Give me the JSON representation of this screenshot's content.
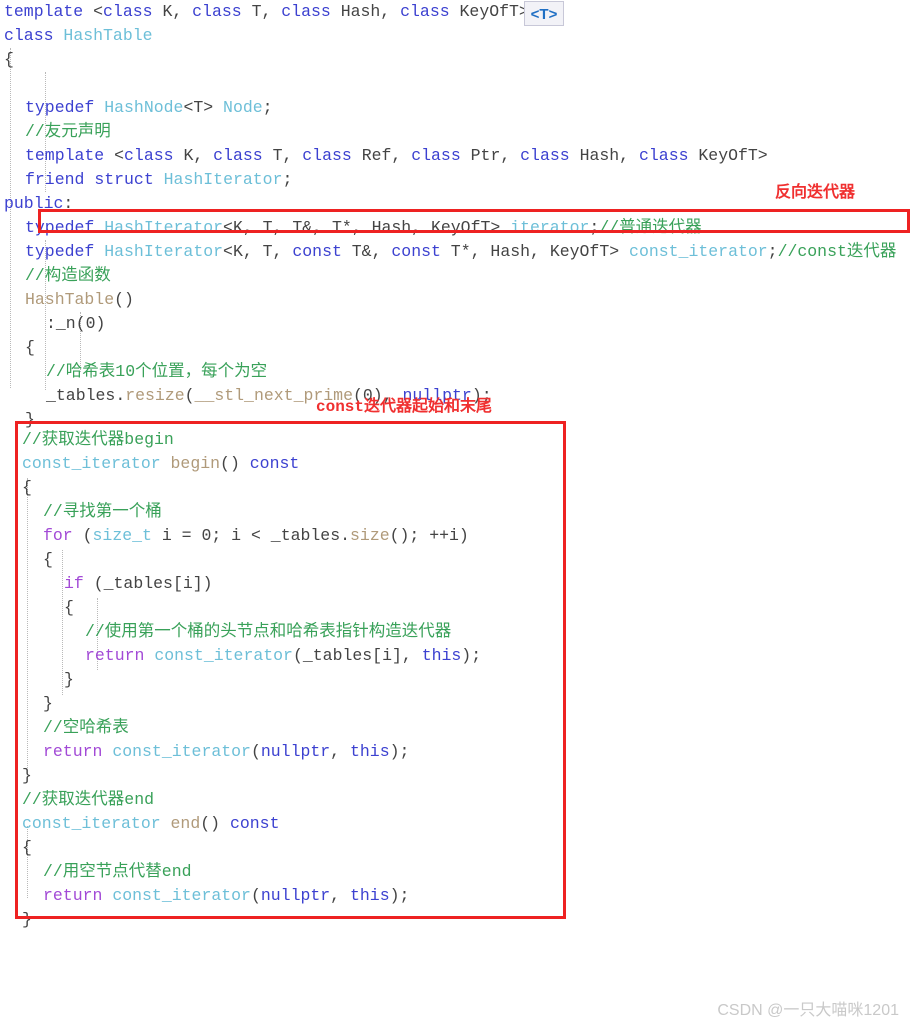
{
  "badge": {
    "label": "<T>"
  },
  "watermark": {
    "text": "CSDN @一只大喵咪1201"
  },
  "annotations": [
    {
      "name": "reverse-iterator-note",
      "text": "反向迭代器",
      "color": "#f03030"
    },
    {
      "name": "const-iterator-begin-end-note",
      "text": "const迭代器起始和末尾",
      "color": "#f03030"
    }
  ],
  "highlight_boxes": [
    {
      "name": "const-iterator-typedef-box",
      "color": "#ee2222"
    },
    {
      "name": "const-iterator-functions-box",
      "color": "#ee2222"
    }
  ],
  "code": {
    "language": "C++",
    "lines": [
      {
        "n": 1,
        "indent": 0,
        "tokens": [
          {
            "t": "template",
            "c": "kw"
          },
          {
            "t": " ",
            "c": "ident"
          },
          {
            "t": "<",
            "c": "ident"
          },
          {
            "t": "class",
            "c": "kw"
          },
          {
            "t": " K, ",
            "c": "ident"
          },
          {
            "t": "class",
            "c": "kw"
          },
          {
            "t": " T, ",
            "c": "ident"
          },
          {
            "t": "class",
            "c": "kw"
          },
          {
            "t": " Hash, ",
            "c": "ident"
          },
          {
            "t": "class",
            "c": "kw"
          },
          {
            "t": " KeyOfT>",
            "c": "ident"
          }
        ]
      },
      {
        "n": 2,
        "indent": 0,
        "tokens": [
          {
            "t": "class",
            "c": "kw"
          },
          {
            "t": " ",
            "c": "ident"
          },
          {
            "t": "HashTable",
            "c": "type"
          }
        ]
      },
      {
        "n": 3,
        "indent": 0,
        "tokens": [
          {
            "t": "{",
            "c": "ident"
          }
        ]
      },
      {
        "n": 4,
        "indent": 0,
        "tokens": []
      },
      {
        "n": 5,
        "indent": 1,
        "tokens": [
          {
            "t": "typedef",
            "c": "kw"
          },
          {
            "t": " ",
            "c": "ident"
          },
          {
            "t": "HashNode",
            "c": "type"
          },
          {
            "t": "<T> ",
            "c": "ident"
          },
          {
            "t": "Node",
            "c": "type"
          },
          {
            "t": ";",
            "c": "ident"
          }
        ]
      },
      {
        "n": 6,
        "indent": 1,
        "tokens": [
          {
            "t": "//友元声明",
            "c": "cmt"
          }
        ]
      },
      {
        "n": 7,
        "indent": 1,
        "tokens": [
          {
            "t": "template",
            "c": "kw"
          },
          {
            "t": " <",
            "c": "ident"
          },
          {
            "t": "class",
            "c": "kw"
          },
          {
            "t": " K, ",
            "c": "ident"
          },
          {
            "t": "class",
            "c": "kw"
          },
          {
            "t": " T, ",
            "c": "ident"
          },
          {
            "t": "class",
            "c": "kw"
          },
          {
            "t": " Ref, ",
            "c": "ident"
          },
          {
            "t": "class",
            "c": "kw"
          },
          {
            "t": " Ptr, ",
            "c": "ident"
          },
          {
            "t": "class",
            "c": "kw"
          },
          {
            "t": " Hash, ",
            "c": "ident"
          },
          {
            "t": "class",
            "c": "kw"
          },
          {
            "t": " KeyOfT>",
            "c": "ident"
          }
        ]
      },
      {
        "n": 8,
        "indent": 1,
        "tokens": [
          {
            "t": "friend",
            "c": "kw"
          },
          {
            "t": " ",
            "c": "ident"
          },
          {
            "t": "struct",
            "c": "kw"
          },
          {
            "t": " ",
            "c": "ident"
          },
          {
            "t": "HashIterator",
            "c": "type"
          },
          {
            "t": ";",
            "c": "ident"
          }
        ]
      },
      {
        "n": 9,
        "indent": 0,
        "tokens": [
          {
            "t": "public",
            "c": "kw"
          },
          {
            "t": ":",
            "c": "ident"
          }
        ]
      },
      {
        "n": 10,
        "indent": 1,
        "tokens": [
          {
            "t": "typedef",
            "c": "kw"
          },
          {
            "t": " ",
            "c": "ident"
          },
          {
            "t": "HashIterator",
            "c": "type"
          },
          {
            "t": "<K, T, T&, T*, Hash, KeyOfT> ",
            "c": "ident"
          },
          {
            "t": "iterator",
            "c": "type"
          },
          {
            "t": ";",
            "c": "ident"
          },
          {
            "t": "//普通迭代器",
            "c": "cmt"
          }
        ]
      },
      {
        "n": 11,
        "indent": 1,
        "tokens": [
          {
            "t": "typedef",
            "c": "kw"
          },
          {
            "t": " ",
            "c": "ident"
          },
          {
            "t": "HashIterator",
            "c": "type"
          },
          {
            "t": "<K, T, ",
            "c": "ident"
          },
          {
            "t": "const",
            "c": "kw"
          },
          {
            "t": " T&, ",
            "c": "ident"
          },
          {
            "t": "const",
            "c": "kw"
          },
          {
            "t": " T*, Hash, KeyOfT> ",
            "c": "ident"
          },
          {
            "t": "const_iterator",
            "c": "type"
          },
          {
            "t": ";",
            "c": "ident"
          },
          {
            "t": "//const迭代器",
            "c": "cmt"
          }
        ]
      },
      {
        "n": 12,
        "indent": 1,
        "tokens": [
          {
            "t": "//构造函数",
            "c": "cmt"
          }
        ]
      },
      {
        "n": 13,
        "indent": 1,
        "tokens": [
          {
            "t": "HashTable",
            "c": "fn"
          },
          {
            "t": "()",
            "c": "ident"
          }
        ]
      },
      {
        "n": 14,
        "indent": 2,
        "tokens": [
          {
            "t": ":",
            "c": "ident"
          },
          {
            "t": "_n",
            "c": "ident"
          },
          {
            "t": "(",
            "c": "ident"
          },
          {
            "t": "0",
            "c": "num"
          },
          {
            "t": ")",
            "c": "ident"
          }
        ]
      },
      {
        "n": 15,
        "indent": 1,
        "tokens": [
          {
            "t": "{",
            "c": "ident"
          }
        ]
      },
      {
        "n": 16,
        "indent": 2,
        "tokens": [
          {
            "t": "//哈希表10个位置，每个为空",
            "c": "cmt"
          }
        ]
      },
      {
        "n": 17,
        "indent": 2,
        "tokens": [
          {
            "t": "_tables",
            "c": "ident"
          },
          {
            "t": ".",
            "c": "ident"
          },
          {
            "t": "resize",
            "c": "fn"
          },
          {
            "t": "(",
            "c": "ident"
          },
          {
            "t": "__stl_next_prime",
            "c": "fn"
          },
          {
            "t": "(",
            "c": "ident"
          },
          {
            "t": "0",
            "c": "num"
          },
          {
            "t": "), ",
            "c": "ident"
          },
          {
            "t": "nullptr",
            "c": "kw"
          },
          {
            "t": ");",
            "c": "ident"
          }
        ]
      },
      {
        "n": 18,
        "indent": 1,
        "tokens": [
          {
            "t": "}",
            "c": "ident"
          }
        ]
      }
    ],
    "boxed_lines": [
      {
        "n": 19,
        "indent": 0,
        "tokens": [
          {
            "t": "//获取迭代器begin",
            "c": "cmt"
          }
        ]
      },
      {
        "n": 20,
        "indent": 0,
        "tokens": [
          {
            "t": "const_iterator",
            "c": "type"
          },
          {
            "t": " ",
            "c": "ident"
          },
          {
            "t": "begin",
            "c": "fn"
          },
          {
            "t": "() ",
            "c": "ident"
          },
          {
            "t": "const",
            "c": "kw"
          }
        ]
      },
      {
        "n": 21,
        "indent": 0,
        "tokens": [
          {
            "t": "{",
            "c": "ident"
          }
        ]
      },
      {
        "n": 22,
        "indent": 1,
        "tokens": [
          {
            "t": "//寻找第一个桶",
            "c": "cmt"
          }
        ]
      },
      {
        "n": 23,
        "indent": 1,
        "tokens": [
          {
            "t": "for",
            "c": "kw2"
          },
          {
            "t": " (",
            "c": "ident"
          },
          {
            "t": "size_t",
            "c": "type"
          },
          {
            "t": " i = ",
            "c": "ident"
          },
          {
            "t": "0",
            "c": "num"
          },
          {
            "t": "; i < ",
            "c": "ident"
          },
          {
            "t": "_tables",
            "c": "ident"
          },
          {
            "t": ".",
            "c": "ident"
          },
          {
            "t": "size",
            "c": "fn"
          },
          {
            "t": "(); ++i)",
            "c": "ident"
          }
        ]
      },
      {
        "n": 24,
        "indent": 1,
        "tokens": [
          {
            "t": "{",
            "c": "ident"
          }
        ]
      },
      {
        "n": 25,
        "indent": 2,
        "tokens": [
          {
            "t": "if",
            "c": "kw2"
          },
          {
            "t": " (",
            "c": "ident"
          },
          {
            "t": "_tables",
            "c": "ident"
          },
          {
            "t": "[i])",
            "c": "ident"
          }
        ]
      },
      {
        "n": 26,
        "indent": 2,
        "tokens": [
          {
            "t": "{",
            "c": "ident"
          }
        ]
      },
      {
        "n": 27,
        "indent": 3,
        "tokens": [
          {
            "t": "//使用第一个桶的头节点和哈希表指针构造迭代器",
            "c": "cmt"
          }
        ]
      },
      {
        "n": 28,
        "indent": 3,
        "tokens": [
          {
            "t": "return",
            "c": "kw2"
          },
          {
            "t": " ",
            "c": "ident"
          },
          {
            "t": "const_iterator",
            "c": "type"
          },
          {
            "t": "(",
            "c": "ident"
          },
          {
            "t": "_tables",
            "c": "ident"
          },
          {
            "t": "[i], ",
            "c": "ident"
          },
          {
            "t": "this",
            "c": "kw"
          },
          {
            "t": ");",
            "c": "ident"
          }
        ]
      },
      {
        "n": 29,
        "indent": 2,
        "tokens": [
          {
            "t": "}",
            "c": "ident"
          }
        ]
      },
      {
        "n": 30,
        "indent": 1,
        "tokens": [
          {
            "t": "}",
            "c": "ident"
          }
        ]
      },
      {
        "n": 31,
        "indent": 1,
        "tokens": [
          {
            "t": "//空哈希表",
            "c": "cmt"
          }
        ]
      },
      {
        "n": 32,
        "indent": 1,
        "tokens": [
          {
            "t": "return",
            "c": "kw2"
          },
          {
            "t": " ",
            "c": "ident"
          },
          {
            "t": "const_iterator",
            "c": "type"
          },
          {
            "t": "(",
            "c": "ident"
          },
          {
            "t": "nullptr",
            "c": "kw"
          },
          {
            "t": ", ",
            "c": "ident"
          },
          {
            "t": "this",
            "c": "kw"
          },
          {
            "t": ");",
            "c": "ident"
          }
        ]
      },
      {
        "n": 33,
        "indent": 0,
        "tokens": [
          {
            "t": "}",
            "c": "ident"
          }
        ]
      },
      {
        "n": 34,
        "indent": 0,
        "tokens": [
          {
            "t": "//获取迭代器end",
            "c": "cmt"
          }
        ]
      },
      {
        "n": 35,
        "indent": 0,
        "tokens": [
          {
            "t": "const_iterator",
            "c": "type"
          },
          {
            "t": " ",
            "c": "ident"
          },
          {
            "t": "end",
            "c": "fn"
          },
          {
            "t": "() ",
            "c": "ident"
          },
          {
            "t": "const",
            "c": "kw"
          }
        ]
      },
      {
        "n": 36,
        "indent": 0,
        "tokens": [
          {
            "t": "{",
            "c": "ident"
          }
        ]
      },
      {
        "n": 37,
        "indent": 1,
        "tokens": [
          {
            "t": "//用空节点代替end",
            "c": "cmt"
          }
        ]
      },
      {
        "n": 38,
        "indent": 1,
        "tokens": [
          {
            "t": "return",
            "c": "kw2"
          },
          {
            "t": " ",
            "c": "ident"
          },
          {
            "t": "const_iterator",
            "c": "type"
          },
          {
            "t": "(",
            "c": "ident"
          },
          {
            "t": "nullptr",
            "c": "kw"
          },
          {
            "t": ", ",
            "c": "ident"
          },
          {
            "t": "this",
            "c": "kw"
          },
          {
            "t": ");",
            "c": "ident"
          }
        ]
      },
      {
        "n": 39,
        "indent": 0,
        "tokens": [
          {
            "t": "}",
            "c": "ident"
          }
        ]
      }
    ]
  }
}
